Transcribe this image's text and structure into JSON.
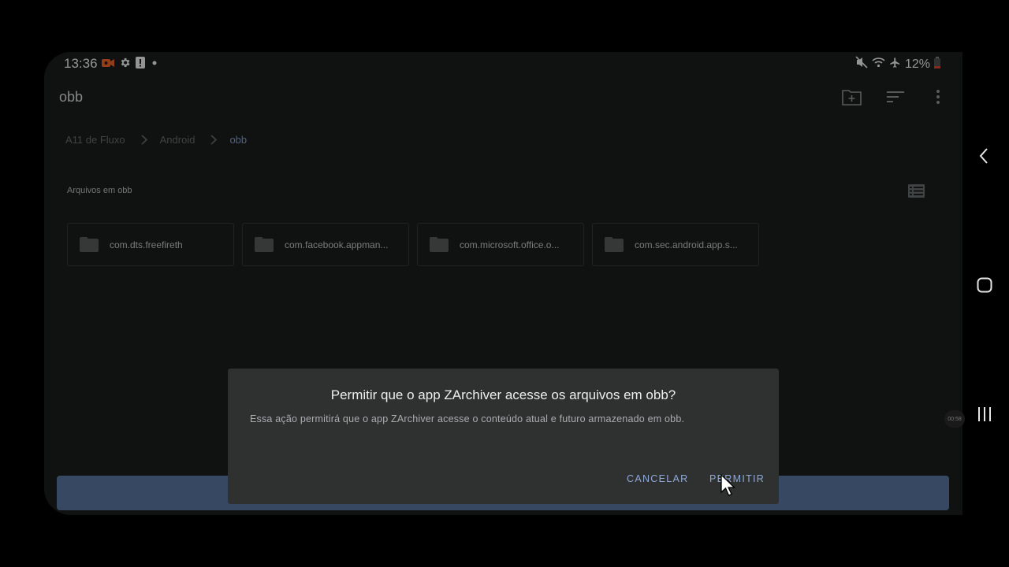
{
  "status_bar": {
    "time": "13:36",
    "battery": "12%",
    "left_icons": [
      "screen-record-icon",
      "gear-icon",
      "alert-icon",
      "dot-icon"
    ],
    "right_icons": [
      "mute-icon",
      "wifi-icon",
      "airplane-icon",
      "battery-icon"
    ],
    "record_color": "#ff6a2b",
    "battery_color": "#e04a3a"
  },
  "toolbar": {
    "title": "obb",
    "actions": [
      "new-folder-icon",
      "sort-icon",
      "more-vert-icon"
    ]
  },
  "breadcrumb": {
    "items": [
      "A11 de Fluxo",
      "Android",
      "obb"
    ]
  },
  "files": {
    "section_label": "Arquivos em obb",
    "folders": [
      "com.dts.freefireth",
      "com.facebook.appman...",
      "com.microsoft.office.o...",
      "com.sec.android.app.s..."
    ]
  },
  "dialog": {
    "title": "Permitir que o app ZArchiver acesse os arquivos em obb?",
    "message": "Essa ação permitirá que o app ZArchiver acesse o conteúdo atual e futuro armazenado em obb.",
    "cancel_label": "CANCELAR",
    "allow_label": "PERMITIR"
  },
  "overlay": {
    "timer": "00:58"
  },
  "colors": {
    "accent": "#8fa8d6",
    "bottom_bar": "#5f7faa",
    "background": "#1c1e1e",
    "dialog": "#2f3131"
  }
}
